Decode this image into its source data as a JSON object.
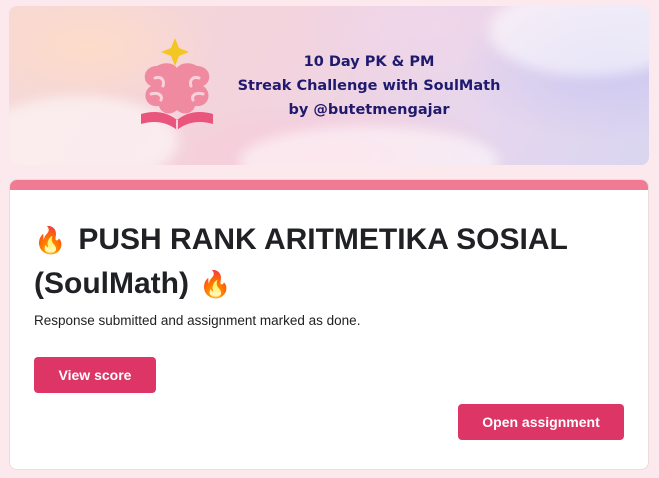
{
  "banner": {
    "logo_icon": "soulmath-brain-book-logo",
    "line1": "10 Day PK & PM",
    "line2": "Streak Challenge with SoulMath",
    "line3": "by @butetmengajar",
    "text_color": "#1f1a6e"
  },
  "card": {
    "accent_color": "#f07b92",
    "title_icon": "fire-icon",
    "title_text": "PUSH RANK ARITMETIKA SOSIAL (SoulMath)",
    "fire_glyph": "🔥",
    "status_text": "Response submitted and assignment marked as done.",
    "view_score_label": "View score",
    "open_assignment_label": "Open assignment",
    "button_color": "#dc3566"
  }
}
